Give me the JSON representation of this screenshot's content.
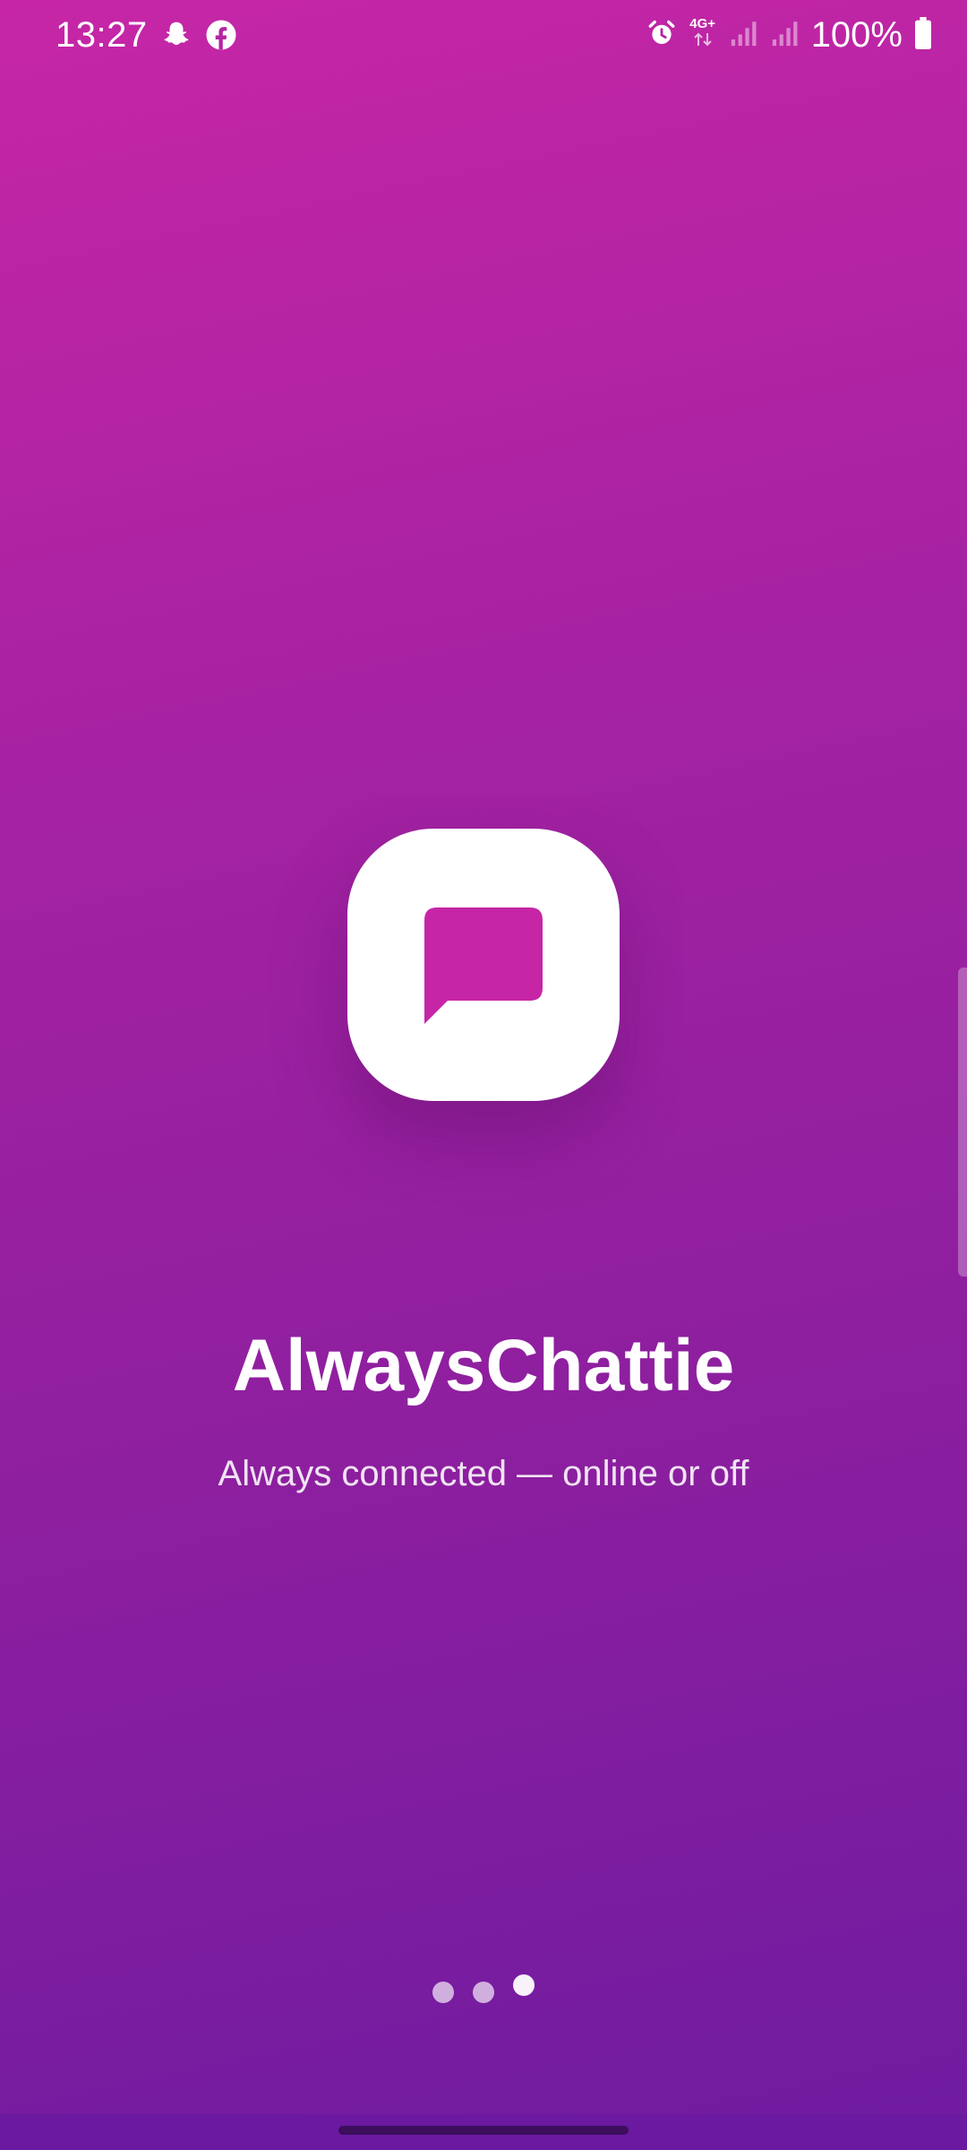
{
  "status_bar": {
    "time": "13:27",
    "notification_icons": [
      "snapchat-icon",
      "facebook-icon"
    ],
    "network_label": "4G+",
    "battery": "100%"
  },
  "app": {
    "logo_icon": "chat-bubble-icon",
    "title": "AlwaysChattie",
    "subtitle": "Always connected — online or off"
  },
  "pager": {
    "total_pages": 3,
    "active_index": 2
  },
  "colors": {
    "gradient_top": "#c626a6",
    "gradient_bottom": "#6e1ba0",
    "logo_bubble": "#c626a6",
    "logo_background": "#ffffff"
  }
}
